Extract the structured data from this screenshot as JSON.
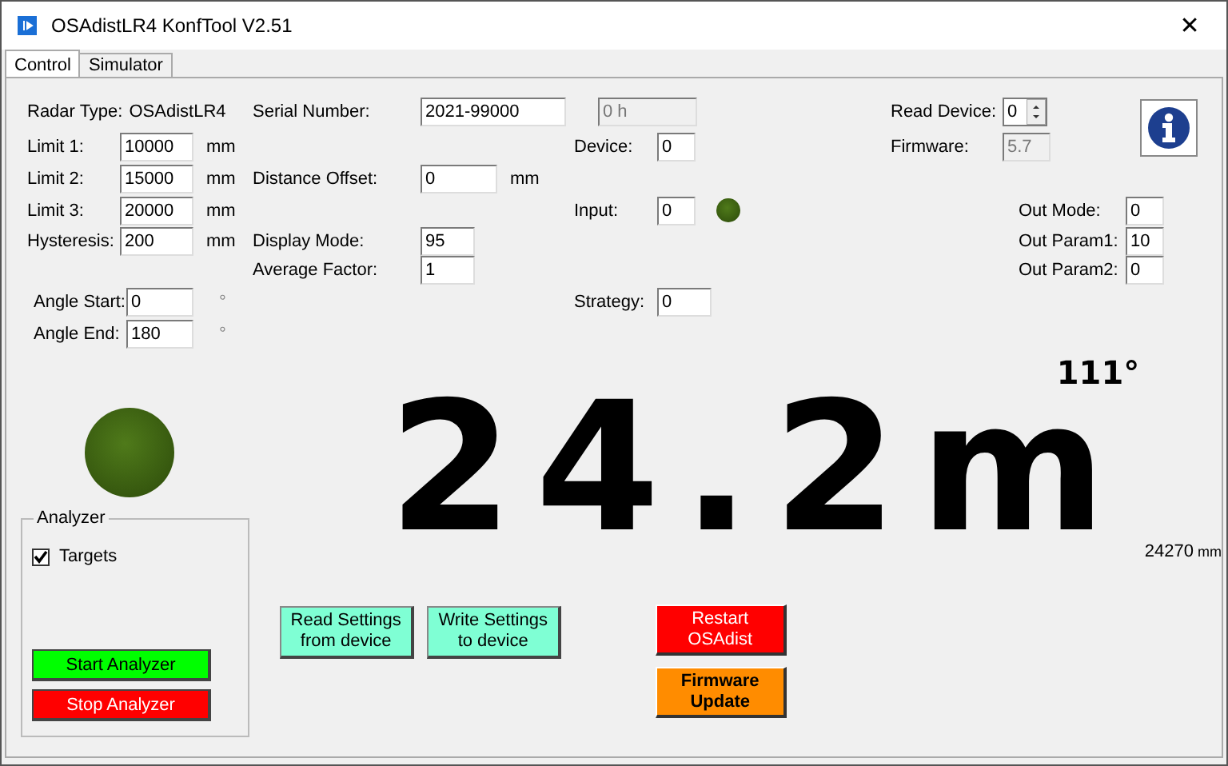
{
  "window": {
    "title": "OSAdistLR4 KonfTool V2.51",
    "close": "✕"
  },
  "tabs": [
    {
      "label": "Control",
      "selected": true
    },
    {
      "label": "Simulator",
      "selected": false
    }
  ],
  "radar_type": {
    "label": "Radar Type:",
    "value": "OSAdistLR4"
  },
  "limits": [
    {
      "label": "Limit 1:",
      "value": "10000",
      "unit": "mm"
    },
    {
      "label": "Limit 2:",
      "value": "15000",
      "unit": "mm"
    },
    {
      "label": "Limit 3:",
      "value": "20000",
      "unit": "mm"
    },
    {
      "label": "Hysteresis:",
      "value": "200",
      "unit": "mm"
    }
  ],
  "angles": [
    {
      "label": "Angle Start:",
      "value": "0",
      "unit": "°"
    },
    {
      "label": "Angle End:",
      "value": "180",
      "unit": "°"
    }
  ],
  "serial": {
    "label": "Serial Number:",
    "value": "2021-99000"
  },
  "hours": {
    "value": "0 h",
    "disabled": true
  },
  "distance_offset": {
    "label": "Distance Offset:",
    "value": "0",
    "unit": "mm"
  },
  "display_mode": {
    "label": "Display Mode:",
    "value": "95"
  },
  "average_factor": {
    "label": "Average Factor:",
    "value": "1"
  },
  "device": {
    "label": "Device:",
    "value": "0"
  },
  "input": {
    "label": "Input:",
    "value": "0",
    "on": false
  },
  "strategy": {
    "label": "Strategy:",
    "value": "0"
  },
  "read_device": {
    "label": "Read Device:",
    "value": "0"
  },
  "firmware": {
    "label": "Firmware:",
    "value": "5.7",
    "disabled": true
  },
  "outputs": [
    {
      "label": "Out Mode:",
      "value": "0"
    },
    {
      "label": "Out Param1:",
      "value": "10"
    },
    {
      "label": "Out Param2:",
      "value": "0"
    }
  ],
  "status_led": {
    "on": false
  },
  "measurement": {
    "distance": "24.2m",
    "angle": "111°",
    "raw": "24270",
    "raw_unit": "mm"
  },
  "analyzer": {
    "title": "Analyzer",
    "targets": {
      "label": "Targets",
      "checked": true
    },
    "buttons": [
      {
        "label": "Start Analyzer",
        "color": "#00ff00"
      },
      {
        "label": "Stop Analyzer",
        "color": "#ff0000"
      }
    ]
  },
  "settings_buttons": [
    {
      "label": "Read Settings from device"
    },
    {
      "label": "Write Settings to device"
    }
  ],
  "device_buttons": [
    {
      "label": "Restart OSAdist",
      "kind": "restart"
    },
    {
      "label": "Firmware Update",
      "kind": "update"
    }
  ]
}
